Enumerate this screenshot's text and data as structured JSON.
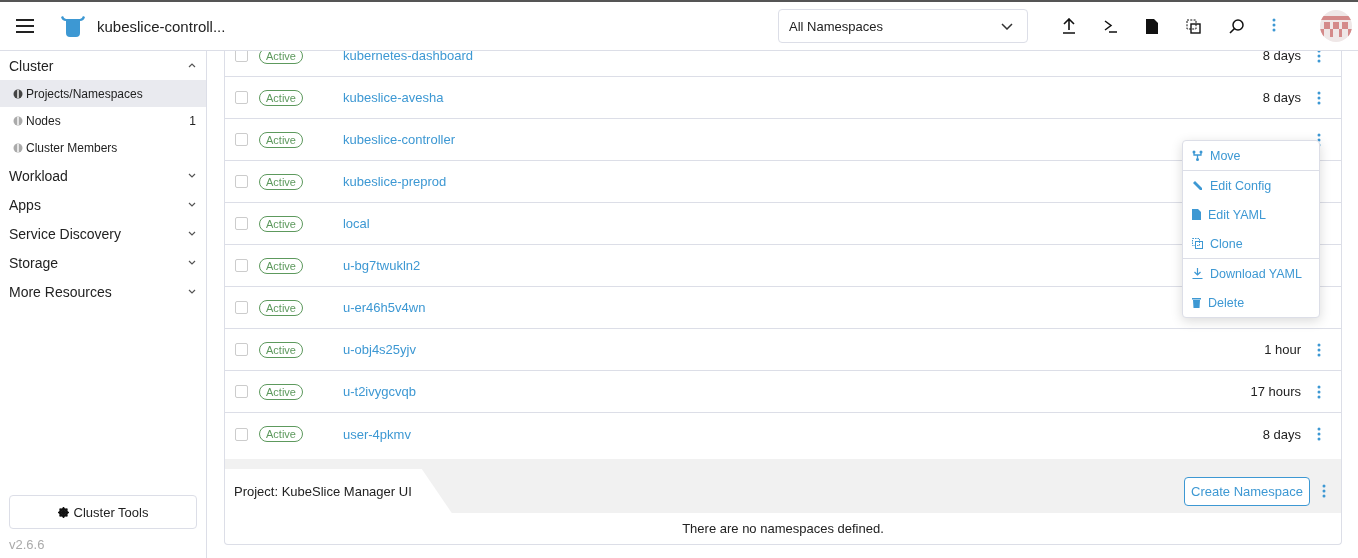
{
  "header": {
    "cluster_name": "kubeslice-controll...",
    "namespace_filter": "All Namespaces"
  },
  "sidebar": {
    "groups": [
      {
        "label": "Cluster",
        "expanded": true,
        "items": [
          {
            "label": "Projects/Namespaces",
            "selected": true
          },
          {
            "label": "Nodes",
            "selected": false,
            "count": "1"
          },
          {
            "label": "Cluster Members",
            "selected": false
          }
        ]
      },
      {
        "label": "Workload",
        "expanded": false
      },
      {
        "label": "Apps",
        "expanded": false
      },
      {
        "label": "Service Discovery",
        "expanded": false
      },
      {
        "label": "Storage",
        "expanded": false
      },
      {
        "label": "More Resources",
        "expanded": false
      }
    ],
    "tools_button": "Cluster Tools",
    "version": "v2.6.6"
  },
  "table": {
    "rows": [
      {
        "checked": false,
        "state": "Active",
        "name": "kubernetes-dashboard",
        "age": "8 days",
        "actions": true
      },
      {
        "checked": false,
        "state": "Active",
        "name": "kubeslice-avesha",
        "age": "8 days",
        "actions": true
      },
      {
        "checked": false,
        "state": "Active",
        "name": "kubeslice-controller",
        "actions": true
      },
      {
        "checked": false,
        "state": "Active",
        "name": "kubeslice-preprod",
        "actions": false
      },
      {
        "checked": false,
        "state": "Active",
        "name": "local",
        "actions": false
      },
      {
        "checked": false,
        "state": "Active",
        "name": "u-bg7twukln2",
        "actions": false
      },
      {
        "checked": false,
        "state": "Active",
        "name": "u-er46h5v4wn",
        "actions": false
      },
      {
        "checked": false,
        "state": "Active",
        "name": "u-obj4s25yjv",
        "age": "1 hour",
        "actions": true
      },
      {
        "checked": false,
        "state": "Active",
        "name": "u-t2ivygcvqb",
        "age": "17 hours",
        "actions": true
      },
      {
        "checked": false,
        "state": "Active",
        "name": "user-4pkmv",
        "age": "8 days",
        "actions": true
      }
    ],
    "group": {
      "label": "Project: KubeSlice Manager UI",
      "create_button": "Create Namespace",
      "empty_message": "There are no namespaces defined."
    }
  },
  "context_menu": {
    "items": [
      {
        "kind": "move",
        "label": "Move",
        "divider_after": true
      },
      {
        "kind": "edit",
        "label": "Edit Config",
        "divider_after": false
      },
      {
        "kind": "file",
        "label": "Edit YAML",
        "divider_after": false
      },
      {
        "kind": "clone",
        "label": "Clone",
        "divider_after": true
      },
      {
        "kind": "download",
        "label": "Download YAML",
        "divider_after": false
      },
      {
        "kind": "delete",
        "label": "Delete",
        "divider_after": false
      }
    ]
  }
}
